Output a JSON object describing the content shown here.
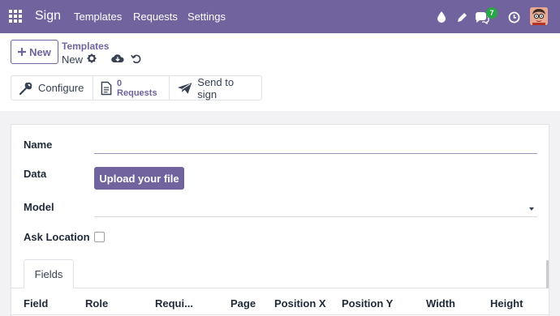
{
  "nav": {
    "brand": "Sign",
    "menu": [
      "Templates",
      "Requests",
      "Settings"
    ],
    "chat_badge": "7",
    "color": "#71639e"
  },
  "control_panel": {
    "new_label": "New",
    "breadcrumb_parent": "Templates",
    "breadcrumb_current": "New",
    "actions": {
      "configure": "Configure",
      "requests": "0 Requests",
      "send": "Send to sign"
    }
  },
  "form": {
    "name_label": "Name",
    "data_label": "Data",
    "upload_label": "Upload your file",
    "model_label": "Model",
    "ask_location_label": "Ask Location"
  },
  "tabs": [
    "Fields"
  ],
  "table": {
    "columns": [
      "Field",
      "Role",
      "Requi...",
      "Page",
      "Position X",
      "Position Y",
      "Width",
      "Height"
    ]
  }
}
